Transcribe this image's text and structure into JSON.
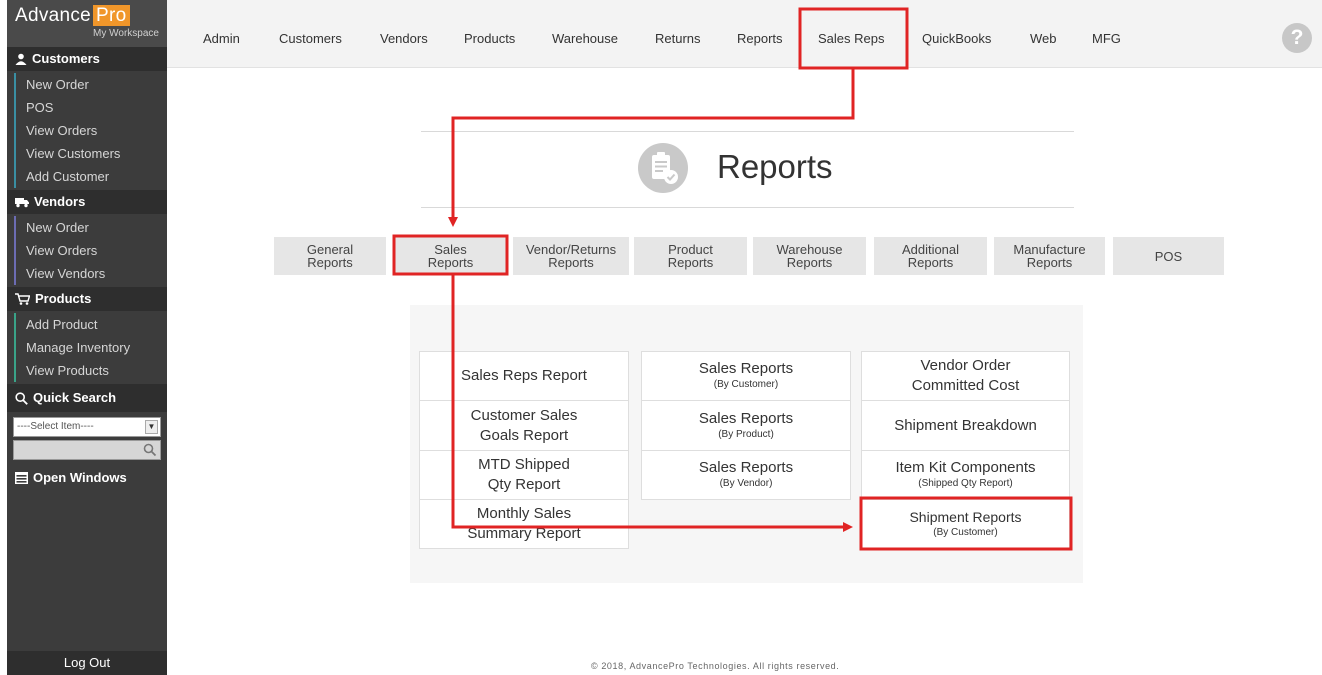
{
  "app": {
    "brand_main": "Advance",
    "brand_accent": "Pro",
    "brand_sub": "My Workspace"
  },
  "sidebar": {
    "customers": {
      "title": "Customers",
      "items": [
        "New Order",
        "POS",
        "View Orders",
        "View Customers",
        "Add Customer"
      ]
    },
    "vendors": {
      "title": "Vendors",
      "items": [
        "New Order",
        "View Orders",
        "View Vendors"
      ]
    },
    "products": {
      "title": "Products",
      "items": [
        "Add Product",
        "Manage Inventory",
        "View Products"
      ]
    },
    "quick_search": {
      "title": "Quick Search",
      "select_value": "----Select Item----",
      "search_value": ""
    },
    "open_windows": "Open Windows",
    "logout": "Log Out"
  },
  "topnav": {
    "items": [
      "Admin",
      "Customers",
      "Vendors",
      "Products",
      "Warehouse",
      "Returns",
      "Reports",
      "Sales Reps",
      "QuickBooks",
      "Web",
      "MFG"
    ],
    "highlighted": "Sales Reps",
    "help": "?"
  },
  "page": {
    "title": "Reports"
  },
  "tabs": [
    {
      "line1": "General",
      "line2": "Reports"
    },
    {
      "line1": "Sales",
      "line2": "Reports"
    },
    {
      "line1": "Vendor/Returns",
      "line2": "Reports"
    },
    {
      "line1": "Product",
      "line2": "Reports"
    },
    {
      "line1": "Warehouse",
      "line2": "Reports"
    },
    {
      "line1": "Additional",
      "line2": "Reports"
    },
    {
      "line1": "Manufacture",
      "line2": "Reports"
    },
    {
      "line1": "POS",
      "line2": ""
    }
  ],
  "reports": {
    "col1": [
      {
        "line1": "Sales Reps Report",
        "line2": ""
      },
      {
        "line1": "Customer Sales",
        "line2": "Goals Report"
      },
      {
        "line1": "MTD Shipped",
        "line2": "Qty Report"
      },
      {
        "line1": "Monthly Sales",
        "line2": "Summary Report"
      }
    ],
    "col2": [
      {
        "title": "Sales Reports",
        "sub": "(By Customer)"
      },
      {
        "title": "Sales Reports",
        "sub": "(By Product)"
      },
      {
        "title": "Sales Reports",
        "sub": "(By Vendor)"
      }
    ],
    "col3": [
      {
        "line1": "Vendor Order",
        "line2": "Committed Cost"
      },
      {
        "line1": "Shipment Breakdown",
        "line2": ""
      },
      {
        "title": "Item Kit Components",
        "sub": "(Shipped Qty Report)"
      },
      {
        "title": "Shipment Reports",
        "sub": "(By Customer)"
      }
    ]
  },
  "footer": "© 2018, AdvancePro Technologies. All rights reserved.",
  "colors": {
    "highlight": "#e02424",
    "accent": "#f0962a",
    "sidebar_bg": "#3c3c3c"
  }
}
